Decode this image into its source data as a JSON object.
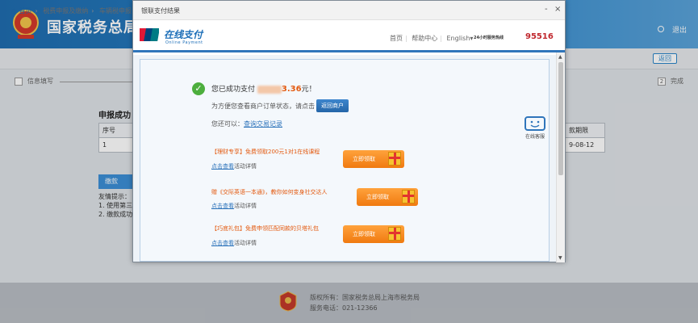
{
  "background": {
    "site_title": "国家税务总局上",
    "header_right": "退出",
    "breadcrumb": [
      "首页",
      "税费申报及缴纳",
      "车辆税申报"
    ],
    "return_label": "返回",
    "step_left": "信息填写",
    "step_right_num": "2",
    "step_right": "完成",
    "section_title": "申报成功",
    "table_left": {
      "header": "序号",
      "row": "1"
    },
    "table_right": {
      "header": "款期限",
      "row": "9-08-12"
    },
    "blue_button": "缴款",
    "notes": [
      "友情提示：",
      "1. 使用第三",
      "2. 缴款成功"
    ],
    "footer_line1": "版权所有：国家税务总局上海市税务局",
    "footer_line2": "服务电话：021-12366"
  },
  "popup": {
    "window_title": "银联支付结果",
    "controls": [
      "-",
      "×"
    ],
    "brand_cn": "在线支付",
    "brand_en": "Online Payment",
    "unionpay_mark": "UnionPay 银联",
    "nav": [
      "首页",
      "帮助中心",
      "English"
    ],
    "hotline_label": "24小时服务热线",
    "hotline_number": "95516",
    "success_prefix": "您已成功支付",
    "success_amount": "3.36",
    "success_suffix": "元！",
    "order_text": "为方便您查看商户订单状态，请点击",
    "order_button": "返回商户",
    "also_prefix": "您还可以：",
    "also_link": "查询交易记录",
    "service_label": "在线客服",
    "promos": [
      {
        "title": "【理财专享】免费领取200元1对1在线课程",
        "detail_link": "点击查看",
        "detail_suffix": "活动详情",
        "button": "立即领取"
      },
      {
        "title": "赠《交际英语一本通》，教你如何变身社交达人",
        "detail_link": "点击查看",
        "detail_suffix": "活动详情",
        "button": "立即领取"
      },
      {
        "title": "【巧底礼包】免费申领匹配同款的贝塔礼包",
        "detail_link": "点击查看",
        "detail_suffix": "活动详情",
        "button": "立即领取"
      }
    ]
  },
  "colors": {
    "accent_blue": "#2f75bb",
    "amount_orange": "#e35a10",
    "hotline_red": "#c0272d",
    "success_green": "#4cae3d"
  }
}
